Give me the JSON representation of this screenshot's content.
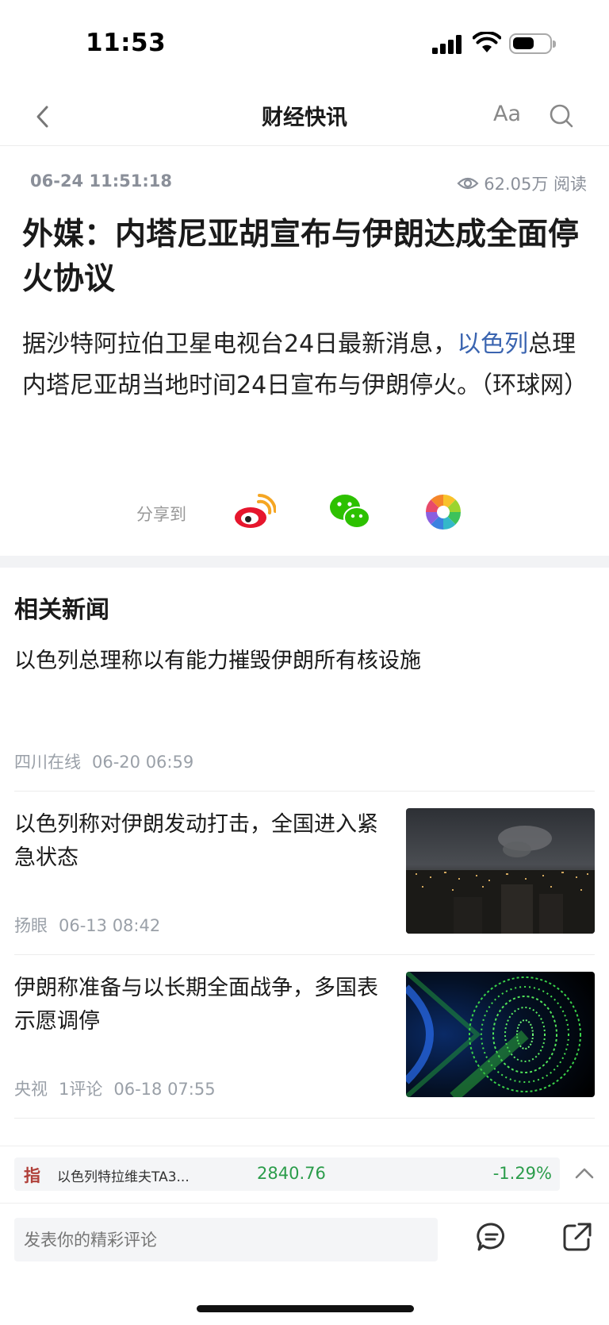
{
  "status_bar": {
    "time": "11:53"
  },
  "nav": {
    "title": "财经快讯",
    "font_size_label": "Aa"
  },
  "article": {
    "datetime": "06-24 11:51:18",
    "views": "62.05万 阅读",
    "headline": "外媒：内塔尼亚胡宣布与伊朗达成全面停火协议",
    "body_part1": "据沙特阿拉伯卫星电视台24日最新消息，",
    "body_link": "以色列",
    "body_part2": "总理内塔尼亚胡当地时间24日宣布与伊朗停火。（环球网）"
  },
  "share": {
    "label": "分享到",
    "targets": [
      "weibo-icon",
      "wechat-icon",
      "moments-icon"
    ]
  },
  "related": {
    "title": "相关新闻",
    "items": [
      {
        "headline": "以色列总理称以有能力摧毁伊朗所有核设施",
        "source": "四川在线",
        "comments": "",
        "time": "06-20 06:59",
        "thumb": ""
      },
      {
        "headline": "以色列称对伊朗发动打击，全国进入紧急状态",
        "source": "扬眼",
        "comments": "",
        "time": "06-13 08:42",
        "thumb": "night-city-smoke"
      },
      {
        "headline": "伊朗称准备与以长期全面战争，多国表示愿调停",
        "source": "央视",
        "comments": "1评论",
        "time": "06-18 07:55",
        "thumb": "binary-tunnel"
      }
    ]
  },
  "ticker": {
    "tag": "指",
    "name": "以色列特拉维夫TA3...",
    "price": "2840.76",
    "change": "-1.29%"
  },
  "comment_bar": {
    "placeholder": "发表你的精彩评论"
  },
  "colors": {
    "link": "#3a64b0",
    "down": "#2a9c4a",
    "tag": "#b0403a"
  }
}
